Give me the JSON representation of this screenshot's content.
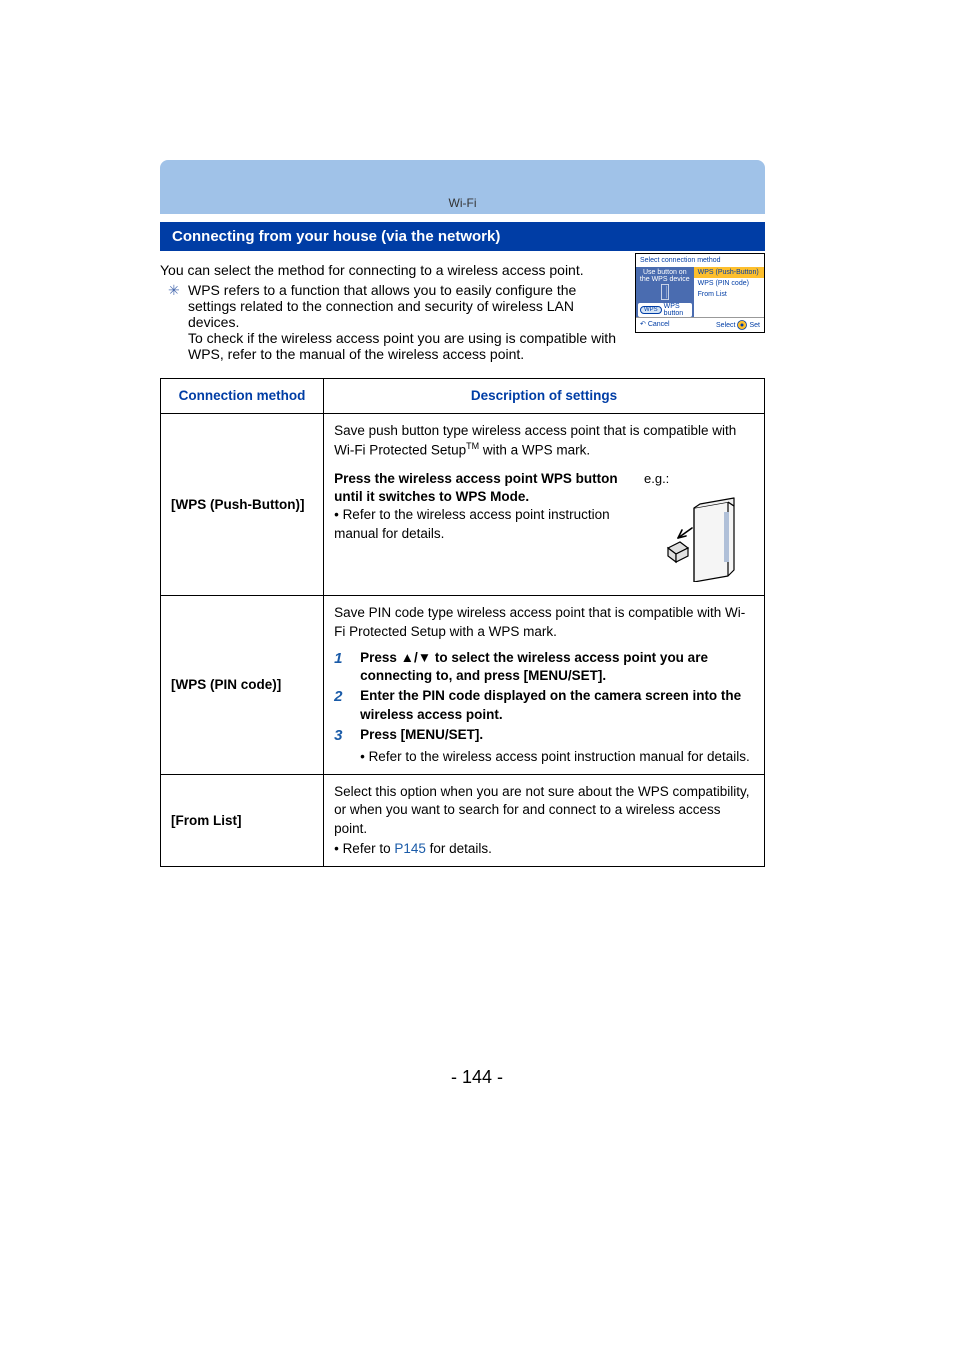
{
  "running_head": "Wi-Fi",
  "section_title": "Connecting from your house (via the network)",
  "lead": "You can select the method for connecting to a wireless access point.",
  "wps_note_a": "WPS refers to a function that allows you to easily configure the settings related to the connection and security of wireless LAN devices.",
  "wps_note_b": "To check if the wireless access point you are using is compatible with WPS, refer to the manual of the wireless access point.",
  "camera_ui": {
    "title": "Select connection method",
    "left_line1": "Use button on",
    "left_line2": "the WPS device",
    "wps_button_label": "WPS button",
    "opt1": "WPS (Push-Button)",
    "opt2": "WPS (PIN code)",
    "opt3": "From List",
    "footer_cancel": "Cancel",
    "footer_select": "Select",
    "footer_set": "Set"
  },
  "table": {
    "th_method": "Connection method",
    "th_desc": "Description of settings",
    "row1": {
      "label": "[WPS (Push-Button)]",
      "intro_a": "Save push button type wireless access point that is compatible with Wi-Fi Protected Setup",
      "intro_b": " with a WPS mark.",
      "tm": "TM",
      "instr_a": "Press the wireless access point WPS button until it switches to WPS Mode.",
      "instr_b": "Refer to the wireless access point instruction manual for details.",
      "eg": "e.g.:"
    },
    "row2": {
      "label": "[WPS (PIN code)]",
      "intro": "Save PIN code type wireless access point that is compatible with Wi-Fi Protected Setup with a WPS mark.",
      "s1": "Press ▲/▼ to select the wireless access point you are connecting to, and press [MENU/SET].",
      "s2": "Enter the PIN code displayed on the camera screen into the wireless access point.",
      "s3": "Press [MENU/SET].",
      "ref": "Refer to the wireless access point instruction manual for details."
    },
    "row3": {
      "label": "[From List]",
      "line_a": "Select this option when you are not sure about the WPS compatibility, or when you want to search for and connect to a wireless access point.",
      "line_b_pre": "Refer to ",
      "line_b_link": "P145",
      "line_b_post": " for details."
    }
  },
  "page_number": "144"
}
